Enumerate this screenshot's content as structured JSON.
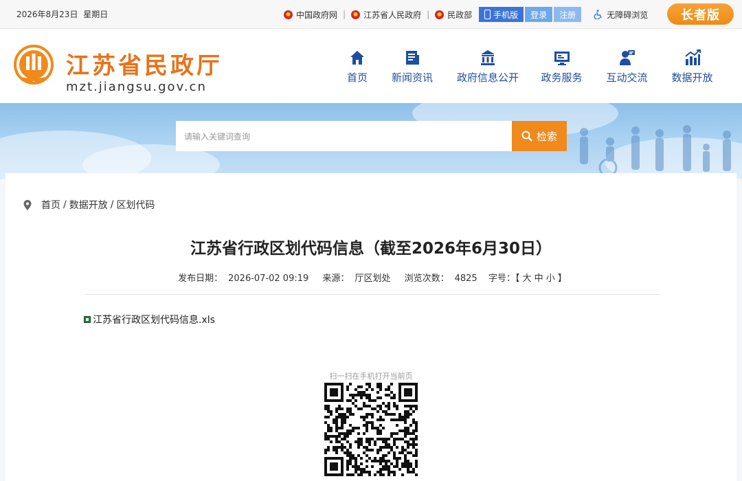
{
  "topbar": {
    "date": "2026年8月23日",
    "weekday": "星期日",
    "links": [
      "中国政府网",
      "江苏省人民政府",
      "民政部"
    ],
    "mobile_label": "手机版",
    "login_label": "登录",
    "register_label": "注册",
    "accessibility_label": "无障碍浏览",
    "elder_label": "长者版"
  },
  "header": {
    "brand_title": "江苏省民政厅",
    "brand_url": "mzt.jiangsu.gov.cn",
    "nav": [
      "首页",
      "新闻资讯",
      "政府信息公开",
      "政务服务",
      "互动交流",
      "数据开放"
    ]
  },
  "search": {
    "placeholder": "请输入关键词查询",
    "button_label": "检索"
  },
  "breadcrumb": {
    "items": [
      "首页",
      "数据开放",
      "区划代码"
    ],
    "divider": "/"
  },
  "article": {
    "title": "江苏省行政区划代码信息（截至2026年6月30日）",
    "publish_label": "发布日期：",
    "publish_date": "2026-07-02 09:19",
    "source_label": "来源：",
    "source": "厅区划处",
    "views_label": "浏览次数：",
    "views": "4825",
    "fontsize_label": "字号：【 大 中 小 】",
    "attachment": "江苏省行政区划代码信息.xls",
    "qr_caption": "扫一扫在手机打开当前页"
  },
  "colors": {
    "accent_orange": "#f08a1d",
    "nav_blue": "#1f4e9e",
    "mobile_blue": "#3b74d8"
  }
}
